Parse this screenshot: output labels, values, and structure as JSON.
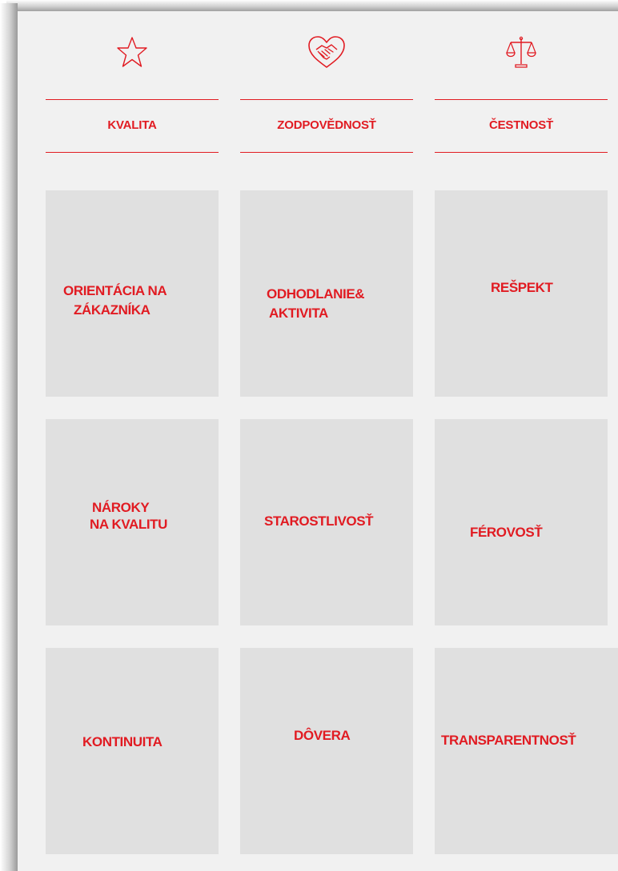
{
  "accent_color": "#e11b22",
  "columns": [
    {
      "icon": "star-icon",
      "title": "KVALITA",
      "items": [
        {
          "lines": [
            "ORIENTÁCIA NA",
            "ZÁKAZNÍKA"
          ]
        },
        {
          "lines": [
            "NÁROKY",
            "NA KVALITU"
          ]
        },
        {
          "lines": [
            "KONTINUITA"
          ]
        }
      ]
    },
    {
      "icon": "heart-handshake-icon",
      "title": "ZODPOVĚDNOSŤ",
      "items": [
        {
          "lines": [
            "ODHODLANIE&",
            "AKTIVITA"
          ]
        },
        {
          "lines": [
            "STAROSTLIVOSŤ"
          ]
        },
        {
          "lines": [
            "DÔVERA"
          ]
        }
      ]
    },
    {
      "icon": "scales-icon",
      "title": "ČESTNOSŤ",
      "items": [
        {
          "lines": [
            "REŠPEKT"
          ]
        },
        {
          "lines": [
            "FÉROVOSŤ"
          ]
        },
        {
          "lines": [
            "TRANSPARENTNOSŤ"
          ]
        }
      ]
    }
  ]
}
